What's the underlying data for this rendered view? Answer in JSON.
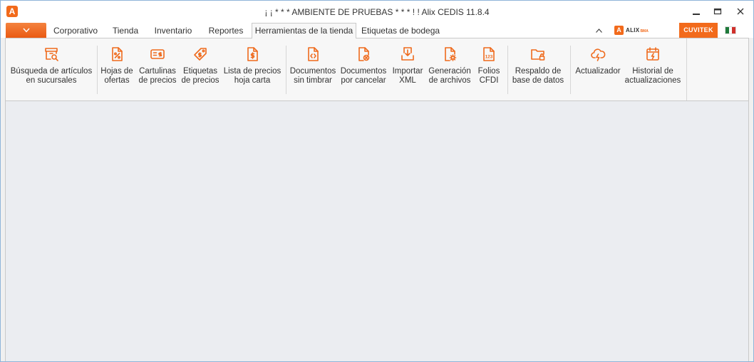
{
  "window": {
    "title": "¡ ¡ * * *  AMBIENTE DE PRUEBAS  * * * ! !      Alix CEDIS 11.8.4",
    "logo_letter": "A"
  },
  "tabs": [
    {
      "label": "Corporativo",
      "active": false
    },
    {
      "label": "Tienda",
      "active": false
    },
    {
      "label": "Inventario",
      "active": false
    },
    {
      "label": "Reportes",
      "active": false
    },
    {
      "label": "Herramientas de la tienda",
      "active": true
    },
    {
      "label": "Etiquetas de bodega",
      "active": false
    }
  ],
  "brand": {
    "alix_letter": "A",
    "alix_text": "ALIX",
    "alix_suffix": "BMA",
    "cuvitek_text": "CUVITEK",
    "accent_color": "#ef6a1c"
  },
  "ribbon": {
    "items": [
      {
        "label": "Búsqueda de artículos\nen sucursales",
        "icon": "box-search-icon"
      },
      {
        "label": "Hojas de\nofertas",
        "icon": "percent-document-icon"
      },
      {
        "label": "Cartulinas\nde precios",
        "icon": "price-card-icon"
      },
      {
        "label": "Etiquetas\nde precios",
        "icon": "price-tag-icon"
      },
      {
        "label": "Lista de precios\nhoja carta",
        "icon": "dollar-document-icon"
      },
      {
        "label": "Documentos\nsin timbrar",
        "icon": "code-document-icon"
      },
      {
        "label": "Documentos\npor cancelar",
        "icon": "cancel-document-icon"
      },
      {
        "label": "Importar\nXML",
        "icon": "import-tray-icon"
      },
      {
        "label": "Generación\nde archivos",
        "icon": "gear-document-icon"
      },
      {
        "label": "Folios\nCFDI",
        "icon": "numbered-document-icon",
        "icon_text": "123"
      },
      {
        "label": "Respaldo de\nbase de datos",
        "icon": "locked-folder-icon"
      },
      {
        "label": "Actualizador",
        "icon": "cloud-lightning-icon"
      },
      {
        "label": "Historial de\nactualizaciones",
        "icon": "calendar-lightning-icon"
      }
    ]
  }
}
